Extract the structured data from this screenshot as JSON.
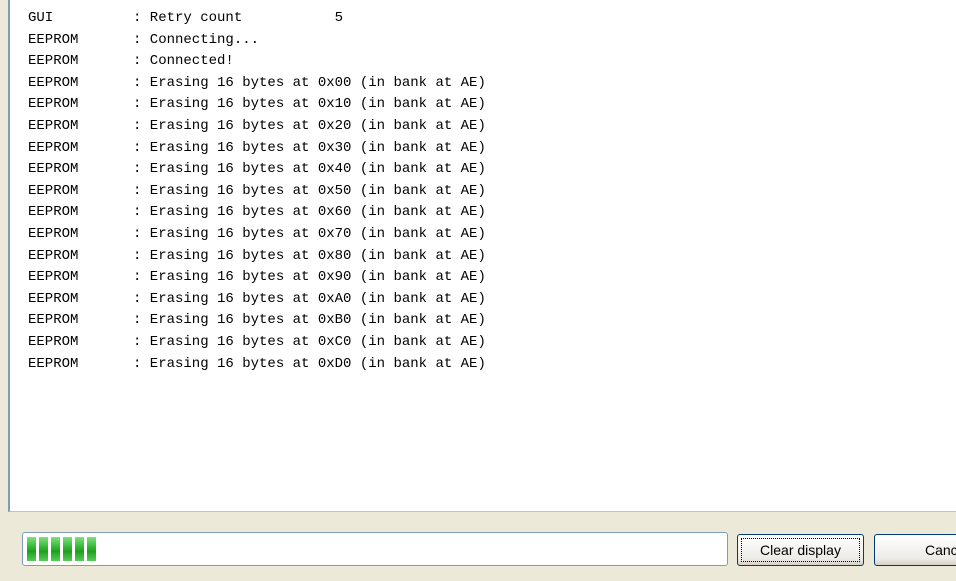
{
  "log": [
    {
      "source": "GUI",
      "message": ": Retry count           5"
    },
    {
      "source": "EEPROM",
      "message": ": Connecting..."
    },
    {
      "source": "EEPROM",
      "message": ": Connected!"
    },
    {
      "source": "EEPROM",
      "message": ": Erasing 16 bytes at 0x00 (in bank at AE)"
    },
    {
      "source": "EEPROM",
      "message": ": Erasing 16 bytes at 0x10 (in bank at AE)"
    },
    {
      "source": "EEPROM",
      "message": ": Erasing 16 bytes at 0x20 (in bank at AE)"
    },
    {
      "source": "EEPROM",
      "message": ": Erasing 16 bytes at 0x30 (in bank at AE)"
    },
    {
      "source": "EEPROM",
      "message": ": Erasing 16 bytes at 0x40 (in bank at AE)"
    },
    {
      "source": "EEPROM",
      "message": ": Erasing 16 bytes at 0x50 (in bank at AE)"
    },
    {
      "source": "EEPROM",
      "message": ": Erasing 16 bytes at 0x60 (in bank at AE)"
    },
    {
      "source": "EEPROM",
      "message": ": Erasing 16 bytes at 0x70 (in bank at AE)"
    },
    {
      "source": "EEPROM",
      "message": ": Erasing 16 bytes at 0x80 (in bank at AE)"
    },
    {
      "source": "EEPROM",
      "message": ": Erasing 16 bytes at 0x90 (in bank at AE)"
    },
    {
      "source": "EEPROM",
      "message": ": Erasing 16 bytes at 0xA0 (in bank at AE)"
    },
    {
      "source": "EEPROM",
      "message": ": Erasing 16 bytes at 0xB0 (in bank at AE)"
    },
    {
      "source": "EEPROM",
      "message": ": Erasing 16 bytes at 0xC0 (in bank at AE)"
    },
    {
      "source": "EEPROM",
      "message": ": Erasing 16 bytes at 0xD0 (in bank at AE)"
    }
  ],
  "progress": {
    "blocks": 6,
    "color": "#2fb52f"
  },
  "buttons": {
    "clear_label": "Clear display",
    "cancel_label": "Cancel"
  },
  "colors": {
    "background": "#ece9d8",
    "log_background": "#ffffff",
    "border": "#7f9db9"
  }
}
